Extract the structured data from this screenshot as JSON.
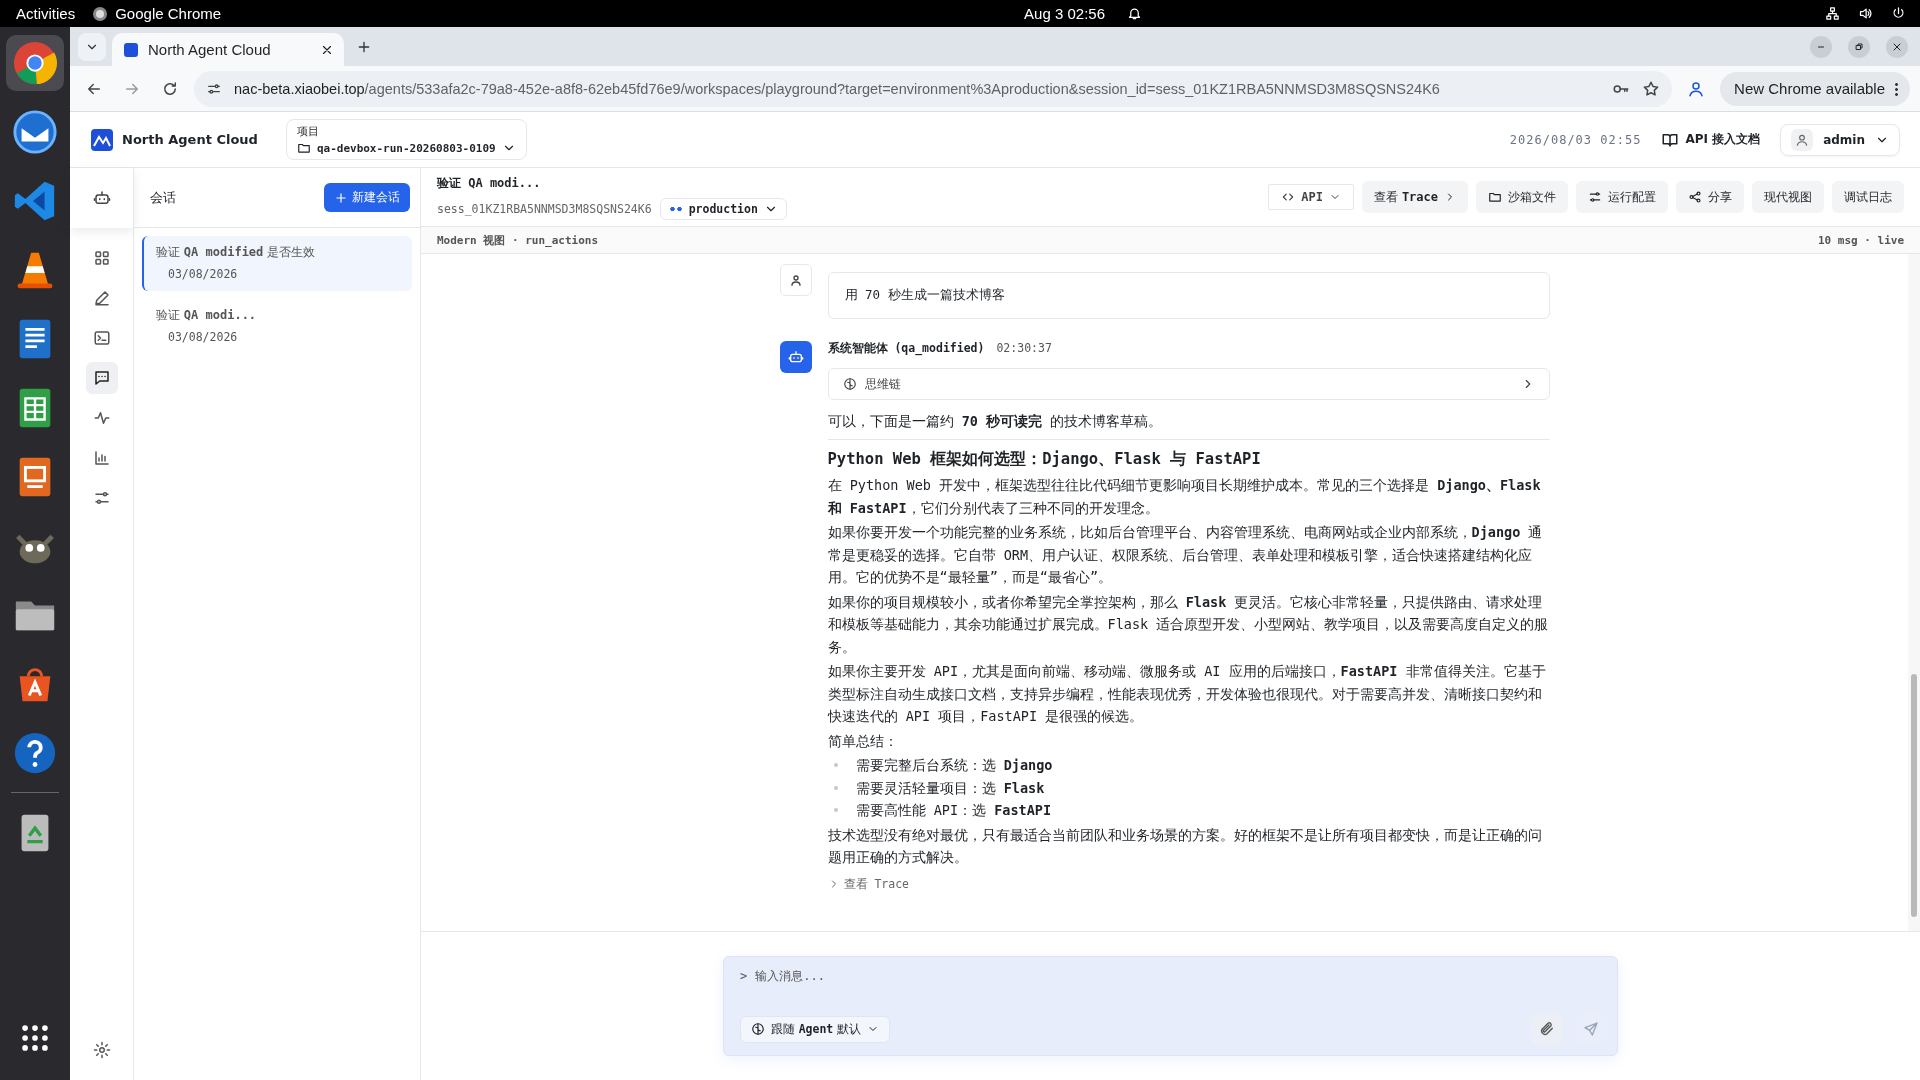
{
  "system_bar": {
    "activities": "Activities",
    "app_name": "Google Chrome",
    "clock": "Aug 3  02:56"
  },
  "dock": [
    {
      "kind": "chrome",
      "selected": true
    },
    {
      "kind": "mail",
      "selected": false
    },
    {
      "kind": "code",
      "selected": false
    },
    {
      "kind": "cone",
      "selected": false
    },
    {
      "kind": "writer",
      "selected": false
    },
    {
      "kind": "calc",
      "selected": false
    },
    {
      "kind": "impress",
      "selected": false
    },
    {
      "kind": "gimp",
      "selected": false
    },
    {
      "kind": "files",
      "selected": false
    },
    {
      "kind": "store",
      "selected": false
    },
    {
      "kind": "help",
      "selected": false
    },
    {
      "kind": "trash",
      "selected": false
    },
    {
      "kind": "apps",
      "selected": false
    }
  ],
  "browser": {
    "tab_title": "North Agent Cloud",
    "url_domain": "nac-beta.xiaobei.top",
    "url_path": "/agents/533afa2c-79a8-452e-a8f8-62eb45fd76e9/workspaces/playground?target=environment%3Aproduction&session_id=sess_01KZ1RBA5NNMSD3M8SQSNS24K6",
    "update_button": "New Chrome available"
  },
  "app_header": {
    "brand": "North Agent Cloud",
    "project_label": "项目",
    "project": "qa-devbox-run-20260803-0109",
    "datetime": "2026/08/03 02:55",
    "docs_link": "API 接入文档",
    "user": "admin"
  },
  "nav_rail": [
    {
      "kind": "grid",
      "selected": false
    },
    {
      "kind": "pencil",
      "selected": false
    },
    {
      "kind": "terminal",
      "selected": false
    },
    {
      "kind": "chat",
      "selected": true
    },
    {
      "kind": "pulse",
      "selected": false
    },
    {
      "kind": "chart",
      "selected": false
    },
    {
      "kind": "sliders",
      "selected": false
    }
  ],
  "sessions": {
    "title": "会话",
    "new_button": "新建会话",
    "items": [
      {
        "title": "验证 **QA modified** 是否生效",
        "date": "03/08/2026",
        "selected": true
      },
      {
        "title": "验证 **QA modi...**",
        "date": "03/08/2026",
        "selected": false
      }
    ]
  },
  "session_header": {
    "title": "验证 QA modi...",
    "session_id": "sess_01KZ1RBA5NNMSD3M8SQSNS24K6",
    "environment": "production",
    "actions": [
      {
        "kind": "api",
        "label": "API"
      },
      {
        "kind": "trace",
        "label": "查看 **Trace**"
      },
      {
        "kind": "files",
        "label": "沙箱文件"
      },
      {
        "kind": "config",
        "label": "运行配置"
      },
      {
        "kind": "share",
        "label": "分享"
      },
      {
        "kind": "plain",
        "label": "现代视图"
      },
      {
        "kind": "plain",
        "label": "调试日志"
      }
    ]
  },
  "view_bar": {
    "left": "Modern 视图 · run_actions",
    "right": "10 msg · live"
  },
  "messages": [
    {
      "kind": "user",
      "text": "用 70 秒生成一篇技术博客"
    },
    {
      "kind": "agent",
      "author": "系统智能体 (qa_modified)",
      "time": "02:30:37",
      "thought": {
        "label": "思维链",
        "expanded": false
      },
      "trace_link": "查看 Trace",
      "blocks": [
        {
          "kind": "paragraph",
          "text": "可以，下面是一篇约 **70 秒可读完** 的技术博客草稿。"
        },
        {
          "kind": "divider"
        },
        {
          "kind": "heading",
          "text": "Python Web 框架如何选型：Django、Flask 与 FastAPI"
        },
        {
          "kind": "paragraph",
          "text": "在 Python Web 开发中，框架选型往往比代码细节更影响项目长期维护成本。常见的三个选择是 **Django、Flask 和 FastAPI**，它们分别代表了三种不同的开发理念。"
        },
        {
          "kind": "paragraph",
          "text": "如果你要开发一个功能完整的业务系统，比如后台管理平台、内容管理系统、电商网站或企业内部系统，**Django** 通常是更稳妥的选择。它自带 ORM、用户认证、权限系统、后台管理、表单处理和模板引擎，适合快速搭建结构化应用。它的优势不是“最轻量”，而是“最省心”。"
        },
        {
          "kind": "paragraph",
          "text": "如果你的项目规模较小，或者你希望完全掌控架构，那么 **Flask** 更灵活。它核心非常轻量，只提供路由、请求处理和模板等基础能力，其余功能通过扩展完成。Flask 适合原型开发、小型网站、教学项目，以及需要高度自定义的服务。"
        },
        {
          "kind": "paragraph",
          "text": "如果你主要开发 API，尤其是面向前端、移动端、微服务或 AI 应用的后端接口，**FastAPI** 非常值得关注。它基于类型标注自动生成接口文档，支持异步编程，性能表现优秀，开发体验也很现代。对于需要高并发、清晰接口契约和快速迭代的 API 项目，FastAPI 是很强的候选。"
        },
        {
          "kind": "paragraph",
          "text": "简单总结："
        },
        {
          "kind": "list",
          "items": [
            "需要完整后台系统：选 **Django**",
            "需要灵活轻量项目：选 **Flask**",
            "需要高性能 API：选 **FastAPI**"
          ]
        },
        {
          "kind": "paragraph",
          "text": "技术选型没有绝对最优，只有最适合当前团队和业务场景的方案。好的框架不是让所有项目都变快，而是让正确的问题用正确的方式解决。"
        }
      ]
    }
  ],
  "composer": {
    "prompt": ">",
    "placeholder": "输入消息...",
    "mode": "跟随 **Agent** 默认",
    "send_disabled": true
  }
}
